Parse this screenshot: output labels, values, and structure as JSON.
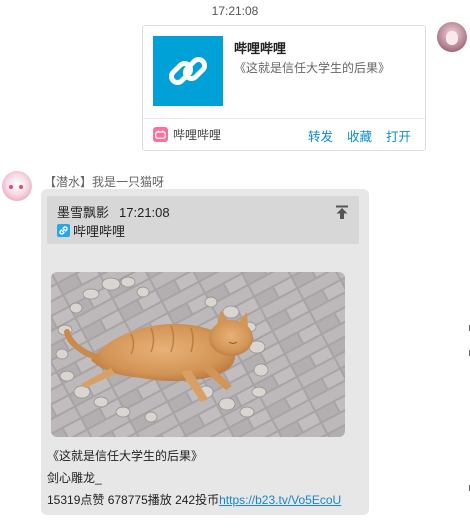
{
  "timestamp": "17:21:08",
  "share_card": {
    "title": "哔哩哔哩",
    "description": "《这就是信任大学生的后果》",
    "source": "哔哩哔哩",
    "actions": [
      "转发",
      "收藏",
      "打开"
    ]
  },
  "message": {
    "sender": "【潜水】我是一只猫呀",
    "quote": {
      "author": "墨雪飘影",
      "time": "17:21:08",
      "link_label": "哔哩哔哩"
    },
    "video_title": "《这就是信任大学生的后果》",
    "uploader": "剑心雕龙_",
    "stats": "15319点赞 678775播放 242投币",
    "url": "https://b23.tv/Vo5EcoU"
  },
  "colors": {
    "accent_blue": "#00a1d6",
    "bilibili_pink": "#fb7299",
    "link_blue": "#1a86c8"
  }
}
